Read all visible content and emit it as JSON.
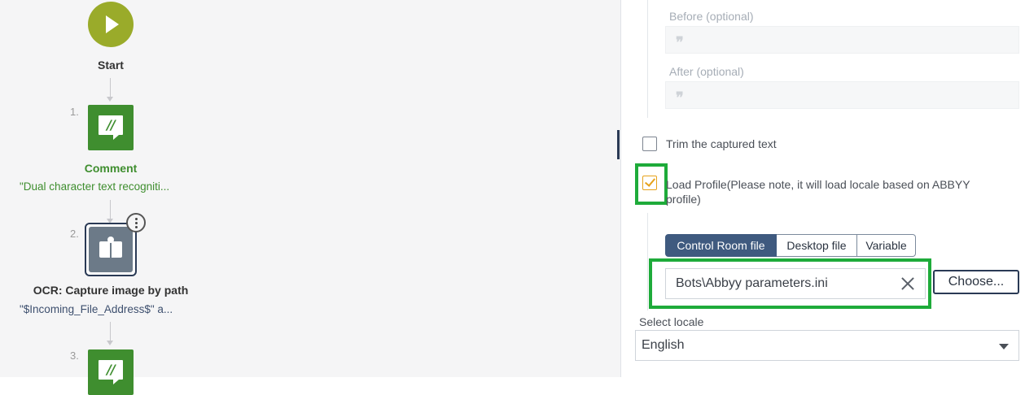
{
  "flow": {
    "start": {
      "label": "Start"
    },
    "steps": [
      {
        "number": "1.",
        "title": "Comment",
        "subtitle": "\"Dual character text recogniti...",
        "icon": "comment-icon",
        "title_color": "#3f8e2f",
        "subtitle_color": "#3f8e2f"
      },
      {
        "number": "2.",
        "title": "OCR: Capture image by path",
        "subtitle": "\"$Incoming_File_Address$\" a...",
        "icon": "ocr-book-icon"
      },
      {
        "number": "3.",
        "icon": "comment-icon"
      }
    ]
  },
  "panel": {
    "before_label": "Before (optional)",
    "after_label": "After (optional)",
    "trim_label": "Trim the captured text",
    "trim_checked": false,
    "load_profile_label_line1": "Load Profile(Please note, it will load locale based on ABBYY",
    "load_profile_label_line2": "profile)",
    "load_profile_checked": true,
    "file_source_tabs": [
      "Control Room file",
      "Desktop file",
      "Variable"
    ],
    "file_source_selected": "Control Room file",
    "file_value": "Bots\\Abbyy parameters.ini",
    "choose_label": "Choose...",
    "select_locale_label": "Select locale",
    "locale_value": "English"
  },
  "colors": {
    "start": "#9aab2a",
    "comment_tile": "#3f8e2f",
    "highlight": "#1eab3a",
    "checkbox_checked": "#e6a21b",
    "tab_active": "#3f5a7f"
  }
}
